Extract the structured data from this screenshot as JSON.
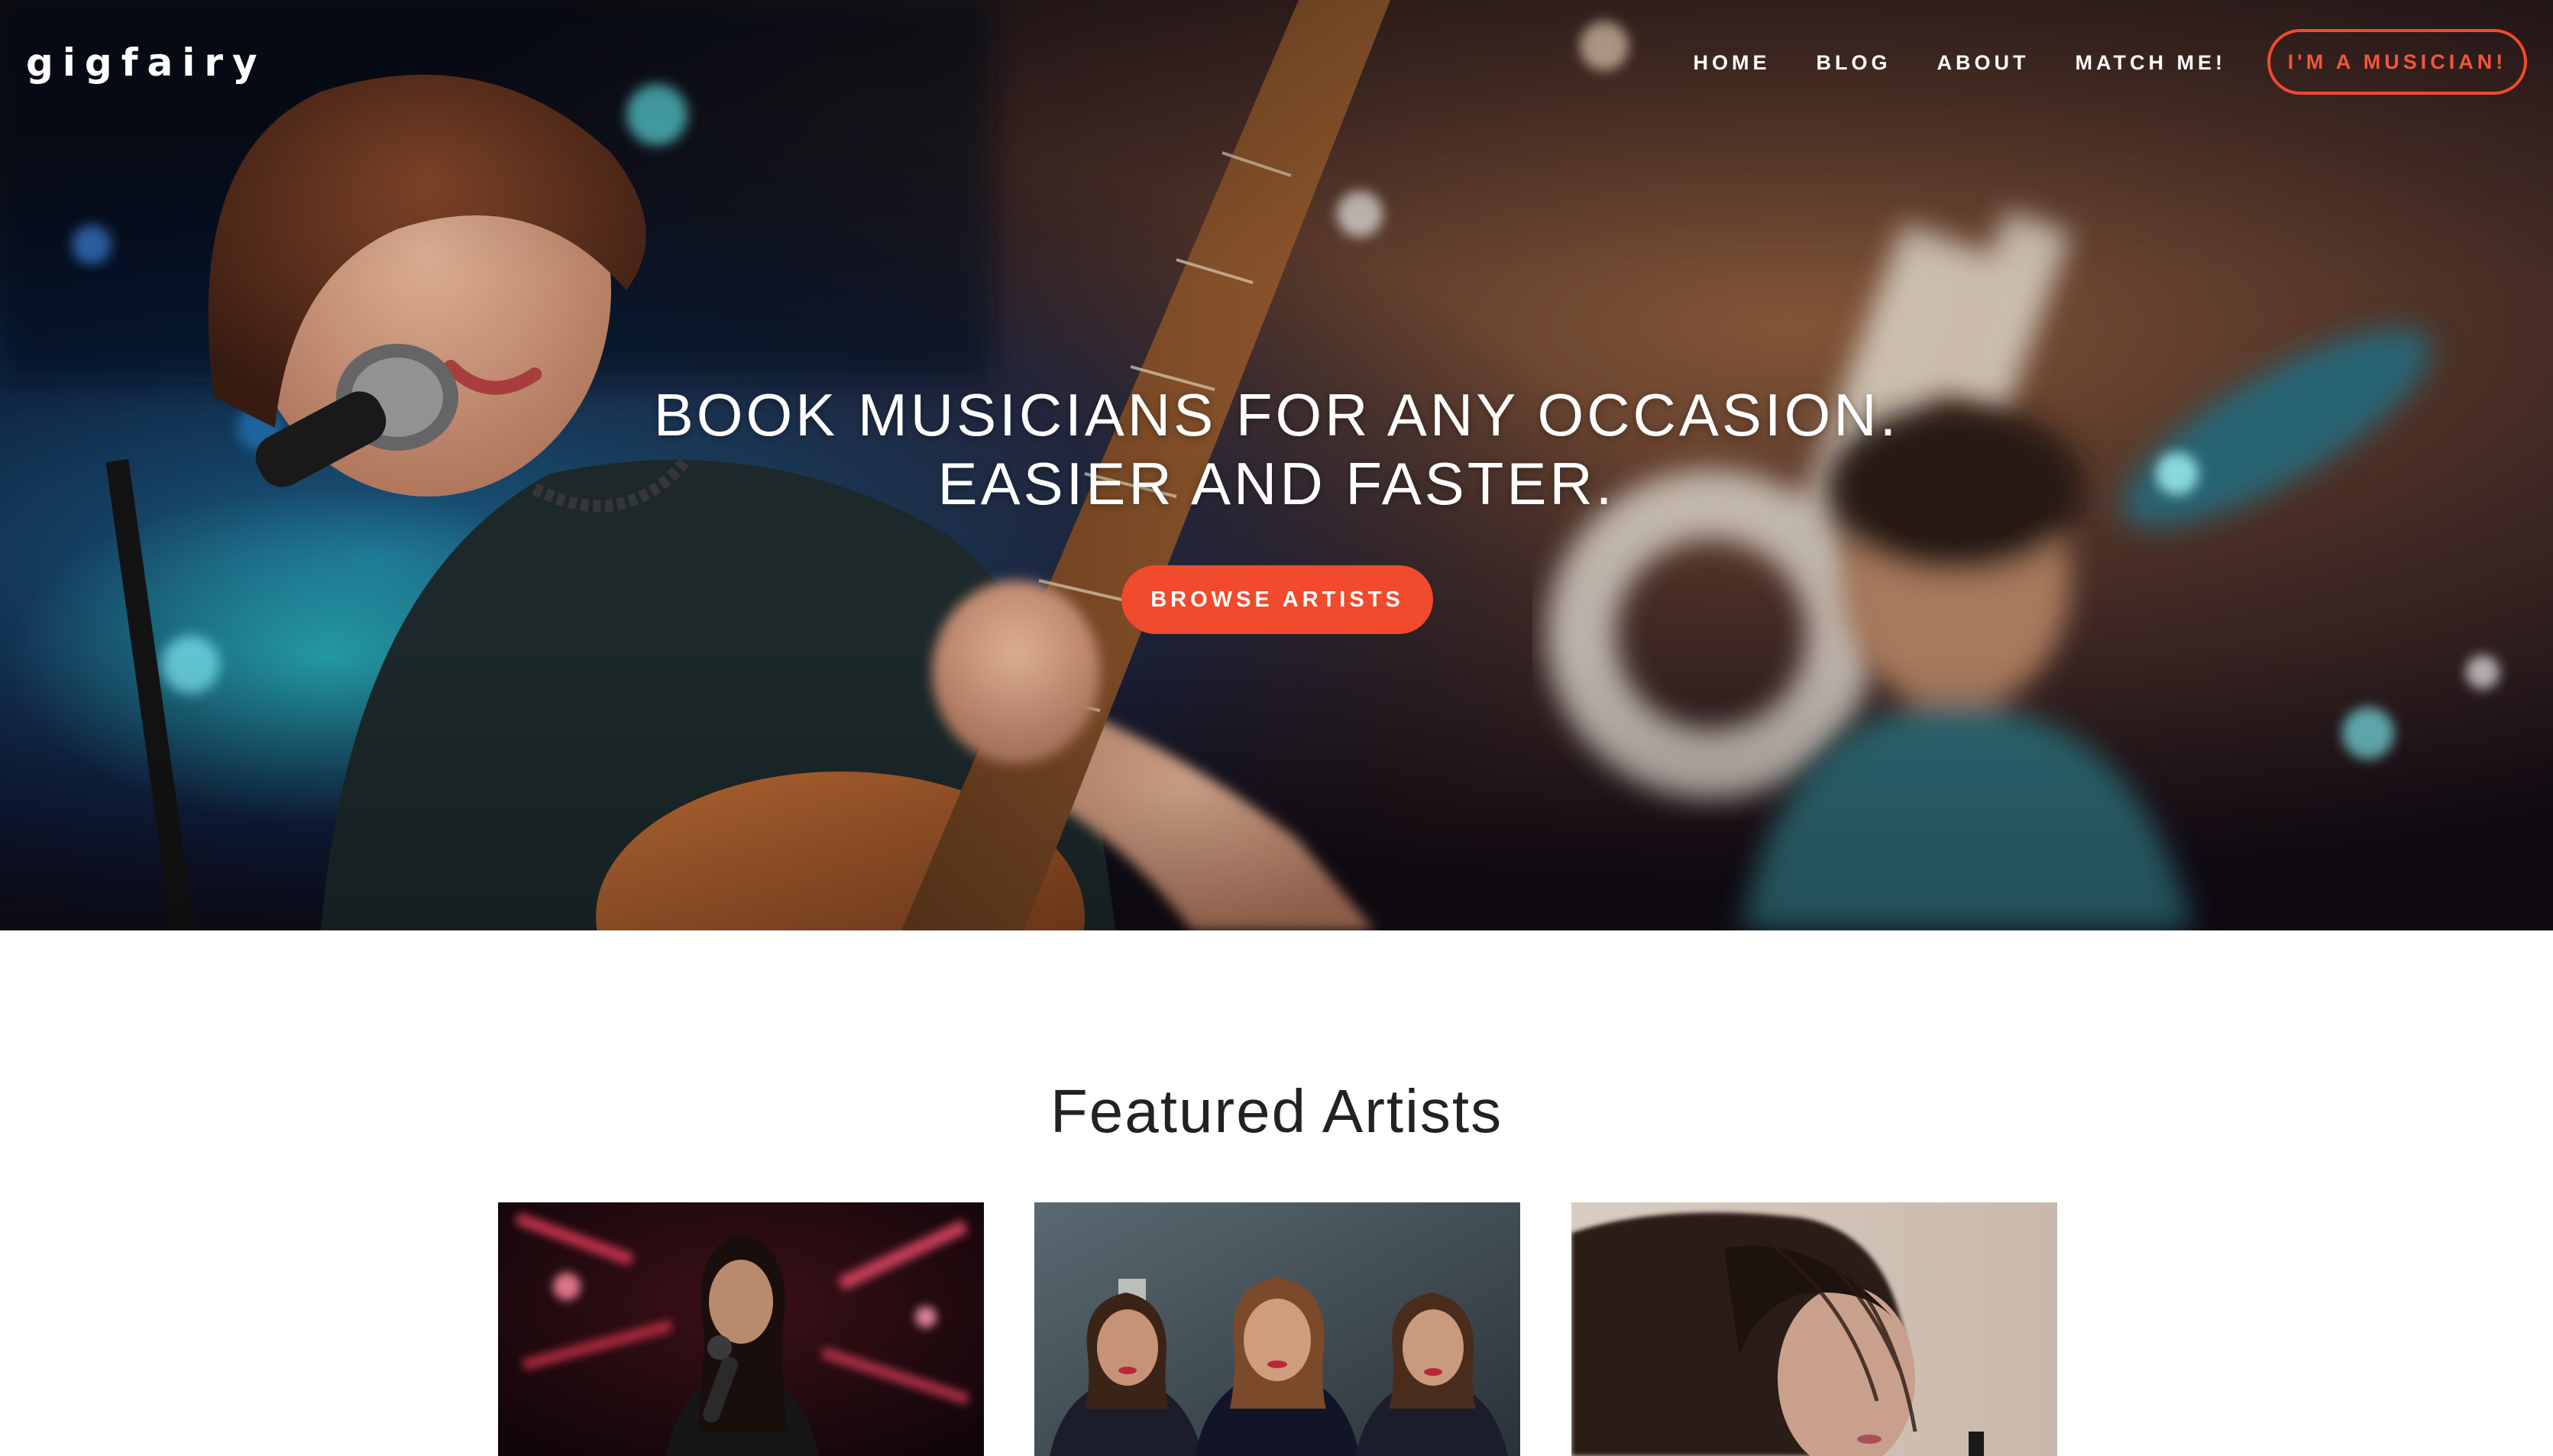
{
  "nav": {
    "logo": "gigfairy",
    "links": [
      {
        "label": "HOME"
      },
      {
        "label": "BLOG"
      },
      {
        "label": "ABOUT"
      },
      {
        "label": "MATCH ME!"
      }
    ],
    "cta_label": "I'M A MUSICIAN!"
  },
  "hero": {
    "headline_line1": "BOOK MUSICIANS FOR ANY OCCASION.",
    "headline_line2": "EASIER AND FASTER.",
    "cta_label": "BROWSE ARTISTS"
  },
  "featured": {
    "title": "Featured Artists",
    "cards": [
      {
        "photo": "singer-with-microphone-red-stage"
      },
      {
        "photo": "three-women-group-portrait"
      },
      {
        "photo": "woman-hair-blowing-sepia"
      }
    ]
  },
  "colors": {
    "accent": "#f24a2c",
    "hero_dark": "#0a0b1e",
    "text_dark": "#222222",
    "white": "#ffffff"
  }
}
